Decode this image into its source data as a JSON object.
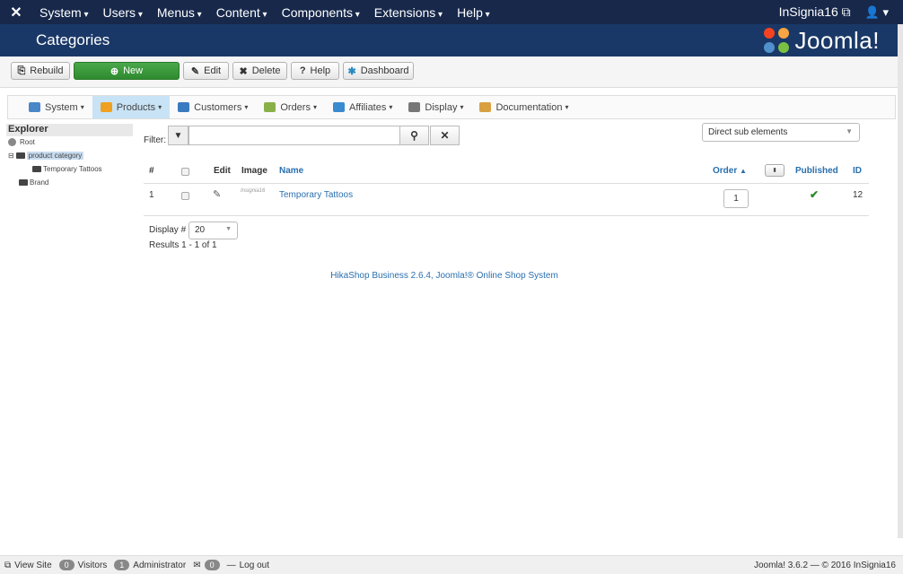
{
  "topnav": {
    "menus": [
      "System",
      "Users",
      "Menus",
      "Content",
      "Components",
      "Extensions",
      "Help"
    ],
    "site_name": "InSignia16",
    "user_icon": "user-icon"
  },
  "header": {
    "title": "Categories",
    "brand": "Joomla!"
  },
  "toolbar": {
    "rebuild": "Rebuild",
    "new": "New",
    "edit": "Edit",
    "delete": "Delete",
    "help": "Help",
    "dashboard": "Dashboard"
  },
  "submenu": [
    {
      "label": "System",
      "color": "#4a86c8"
    },
    {
      "label": "Products",
      "color": "#f0a020",
      "active": true
    },
    {
      "label": "Customers",
      "color": "#3a7ac0"
    },
    {
      "label": "Orders",
      "color": "#8ab04a"
    },
    {
      "label": "Affiliates",
      "color": "#3a8ad0"
    },
    {
      "label": "Display",
      "color": "#777777"
    },
    {
      "label": "Documentation",
      "color": "#d8a040"
    }
  ],
  "explorer": {
    "title": "Explorer",
    "root": "Root",
    "product_category": "product category",
    "temporary_tattoos": "Temporary Tattoos",
    "brand": "Brand"
  },
  "filter": {
    "label": "Filter:",
    "value": "",
    "sub_elements": "Direct sub elements"
  },
  "table": {
    "headers": {
      "num": "#",
      "edit": "Edit",
      "image": "Image",
      "name": "Name",
      "order": "Order",
      "published": "Published",
      "id": "ID"
    },
    "rows": [
      {
        "num": "1",
        "thumb": "Insignia16",
        "name": "Temporary Tattoos",
        "order": "1",
        "id": "12"
      }
    ]
  },
  "pagination": {
    "display_label": "Display #",
    "display_value": "20",
    "results": "Results 1 - 1 of 1"
  },
  "credit": "HikaShop Business 2.6.4, Joomla!® Online Shop System",
  "statusbar": {
    "view_site": "View Site",
    "visitors_count": "0",
    "visitors": "Visitors",
    "admin_count": "1",
    "admin": "Administrator",
    "messages_count": "0",
    "logout": "Log out",
    "version": "Joomla! 3.6.2 — © 2016 InSignia16"
  }
}
